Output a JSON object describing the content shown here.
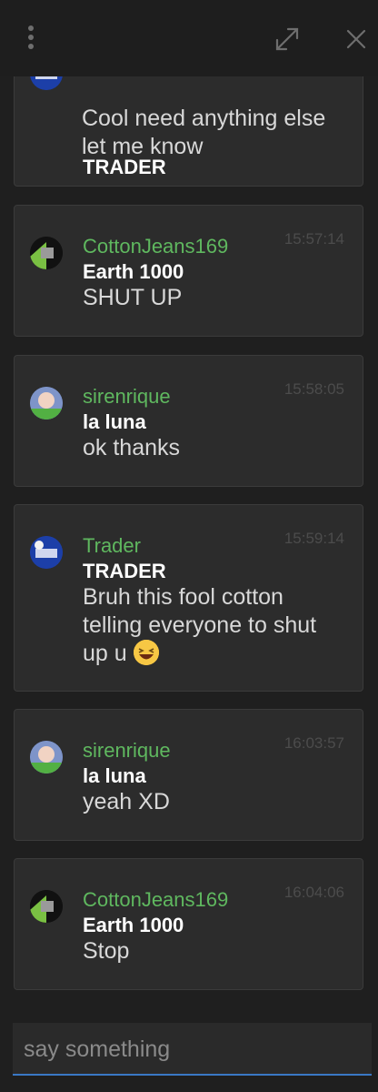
{
  "window": {
    "menu_icon": "kebab-menu-icon",
    "expand_icon": "expand-icon",
    "close_icon": "close-icon"
  },
  "messages": [
    {
      "username": "",
      "display_name": "TRADER",
      "text": "Cool need anything else let me know",
      "time": "",
      "avatar": "trader-avatar"
    },
    {
      "username": "CottonJeans169",
      "display_name": "Earth 1000",
      "text": "SHUT UP",
      "time": "15:57:14",
      "avatar": "cottonjeans-avatar"
    },
    {
      "username": "sirenrique",
      "display_name": "la luna",
      "text": "ok thanks",
      "time": "15:58:05",
      "avatar": "sirenrique-avatar"
    },
    {
      "username": "Trader",
      "display_name": "TRADER",
      "text": "Bruh this fool cotton telling everyone to shut up u",
      "emoji": "laughing-emoji",
      "time": "15:59:14",
      "avatar": "trader-avatar"
    },
    {
      "username": "sirenrique",
      "display_name": "la luna",
      "text": "yeah XD",
      "time": "16:03:57",
      "avatar": "sirenrique-avatar"
    },
    {
      "username": "CottonJeans169",
      "display_name": "Earth 1000",
      "text": "Stop",
      "time": "16:04:06",
      "avatar": "cottonjeans-avatar"
    }
  ],
  "composer": {
    "placeholder": "say something",
    "value": ""
  },
  "colors": {
    "background": "#1f1f1f",
    "card": "#2c2c2c",
    "username": "#5fb85f",
    "accent": "#3a78c4"
  }
}
